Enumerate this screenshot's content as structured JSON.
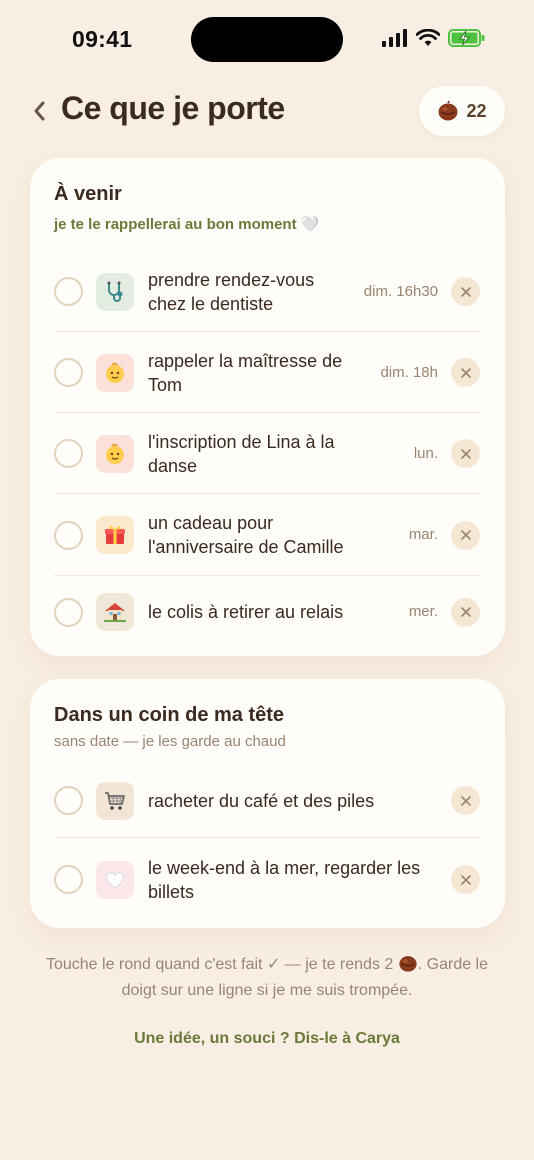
{
  "status_bar": {
    "time": "09:41"
  },
  "header": {
    "back_label": "‹",
    "title": "Ce que je porte",
    "chestnut_count": "22"
  },
  "upcoming": {
    "title": "À venir",
    "subtitle": "je te le rappellerai au bon moment 🤍",
    "items": [
      {
        "line1": "prendre rendez-vous",
        "line2": "chez le dentiste",
        "when": "dim. 16h30",
        "icon": "stethoscope-icon",
        "icon_bg": "#e3ece1"
      },
      {
        "line1": "rappeler la maîtresse de",
        "line2": "Tom",
        "when": "dim. 18h",
        "icon": "baby-face-icon",
        "icon_bg": "#fbe1da"
      },
      {
        "line1": "l'inscription de Lina à la",
        "line2": "danse",
        "when": "lun.",
        "icon": "baby-face-icon",
        "icon_bg": "#fbe1da"
      },
      {
        "line1": "un cadeau pour",
        "line2": "l'anniversaire de Camille",
        "when": "mar.",
        "icon": "gift-icon",
        "icon_bg": "#faeacb"
      },
      {
        "line1": "le colis à retirer au relais",
        "line2": "",
        "when": "mer.",
        "icon": "house-icon",
        "icon_bg": "#efe8d8"
      }
    ]
  },
  "someday": {
    "title": "Dans un coin de ma tête",
    "subtitle": "sans date — je les garde au chaud",
    "items": [
      {
        "line1": "racheter du café et des piles",
        "line2": "",
        "icon": "shopping-cart-icon",
        "icon_bg": "#f3e5d6"
      },
      {
        "line1": "le week-end à la mer, regarder les",
        "line2": "billets",
        "icon": "white-heart-icon",
        "icon_bg": "#fbe6ea"
      }
    ]
  },
  "footer": {
    "hint_part1": "Touche le rond quand c'est fait ✓ — je te rends 2",
    "hint_part2": ". Garde le doigt sur une ligne si je me suis trompée.",
    "feedback_link": "Une idée, un souci ? Dis-le à Carya"
  },
  "colors": {
    "background": "#f8eee3",
    "card": "#fffdf9",
    "accent_green": "#6b7a3a",
    "chestnut": "#8a3a1c"
  }
}
